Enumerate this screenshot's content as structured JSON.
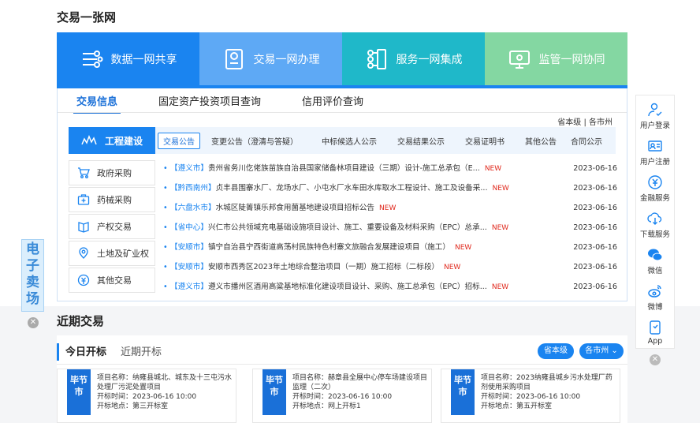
{
  "header": {
    "title": "交易一张网"
  },
  "banner": [
    {
      "label": "数据一网共享",
      "color": "#1a84f0",
      "icon": "data-share-icon"
    },
    {
      "label": "交易一网办理",
      "color": "#5ea9f5",
      "icon": "transaction-doc-icon"
    },
    {
      "label": "服务一网集成",
      "color": "#1fb8c9",
      "icon": "service-integration-icon"
    },
    {
      "label": "监管一网协同",
      "color": "#84d7a2",
      "icon": "monitor-screen-icon"
    }
  ],
  "tabs": [
    "交易信息",
    "固定资产投资项目查询",
    "信用评价查询"
  ],
  "region": {
    "province": "省本级",
    "sep": " | ",
    "city": "各市州"
  },
  "left_menu": {
    "active": "工程建设",
    "items": [
      "政府采购",
      "药械采购",
      "产权交易",
      "土地及矿业权",
      "其他交易"
    ]
  },
  "sub_tabs": [
    "交易公告",
    "变更公告（澄清与答疑）",
    "中标候选人公示",
    "交易结果公示",
    "交易证明书",
    "其他公告",
    "合同公示"
  ],
  "notices": [
    {
      "tag": "【遵义市】",
      "title": "贵州省务川仡佬族苗族自治县国家储备林项目建设（三期）设计-施工总承包（E...",
      "new": "NEW",
      "date": "2023-06-16"
    },
    {
      "tag": "【黔西南州】",
      "title": "贞丰县围寨水厂、龙场水厂、小屯水厂水车田水库取水工程设计、施工及设备采...",
      "new": "NEW",
      "date": "2023-06-16"
    },
    {
      "tag": "【六盘水市】",
      "title": "水城区陡箐镇乐邦食用菌基地建设项目招标公告",
      "new": "NEW",
      "date": "2023-06-16"
    },
    {
      "tag": "【省中心】",
      "title": "兴仁市公共领域充电基础设施项目设计、施工、重要设备及材料采购（EPC）总承...",
      "new": "NEW",
      "date": "2023-06-16"
    },
    {
      "tag": "【安顺市】",
      "title": "镇宁自治县宁西街道高荡村民族特色村寨文旅融合发展建设项目（施工）",
      "new": "NEW",
      "date": "2023-06-16"
    },
    {
      "tag": "【安顺市】",
      "title": "安顺市西秀区2023年土地综合整治项目（一期）施工招标（二标段）",
      "new": "NEW",
      "date": "2023-06-16"
    },
    {
      "tag": "【遵义市】",
      "title": "遵义市播州区酒用高粱基地标准化建设项目设计、采购、施工总承包（EPC）招标...",
      "new": "NEW",
      "date": "2023-06-16"
    }
  ],
  "side_widget": [
    {
      "label": "用户登录",
      "icon": "user-login-icon"
    },
    {
      "label": "用户注册",
      "icon": "user-register-icon"
    },
    {
      "label": "金融服务",
      "icon": "finance-icon"
    },
    {
      "label": "下载服务",
      "icon": "cloud-download-icon"
    },
    {
      "label": "微信",
      "icon": "wechat-icon"
    },
    {
      "label": "微博",
      "icon": "weibo-icon"
    },
    {
      "label": "App",
      "icon": "app-icon"
    }
  ],
  "left_float": {
    "text": "电子卖场"
  },
  "recent": {
    "title": "近期交易",
    "tabs": {
      "active": "今日开标",
      "other": "近期开标"
    },
    "buttons": {
      "province": "省本级",
      "city": "各市州 ⌄"
    },
    "cards": [
      {
        "badge": "毕节市",
        "name_label": "项目名称：",
        "name": "纳雍县城北、城东及十三屯污水处理厂污泥处置项目",
        "time_label": "开标时间：",
        "time": "2023-06-16 10:00",
        "place_label": "开标地点：",
        "place": "第三开标室"
      },
      {
        "badge": "毕节市",
        "name_label": "项目名称：",
        "name": "赫章县全展中心停车场建设项目监理（二次）",
        "time_label": "开标时间：",
        "time": "2023-06-16 10:00",
        "place_label": "开标地点：",
        "place": "网上开标1"
      },
      {
        "badge": "毕节市",
        "name_label": "项目名称：",
        "name": "2023纳雍县城乡污水处理厂药剂使用采购项目",
        "time_label": "开标时间：",
        "time": "2023-06-16 10:00",
        "place_label": "开标地点：",
        "place": "第五开标室"
      }
    ]
  }
}
